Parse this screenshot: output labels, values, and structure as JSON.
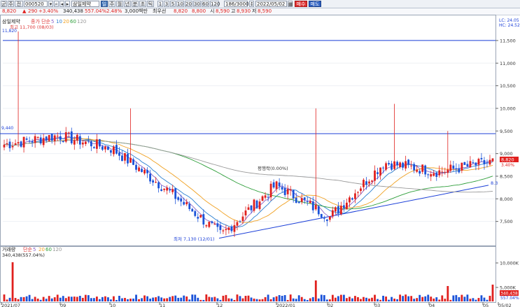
{
  "toolbar": {
    "code": "000520",
    "name": "삼일제약",
    "buttons": [
      "주",
      "월",
      "년",
      "분",
      "초",
      "틱"
    ],
    "selected_button": "일",
    "periods": [
      "1",
      "3",
      "5",
      "10",
      "20",
      "30",
      "60",
      "120"
    ],
    "count": "186/3000",
    "date": "2022/05/02",
    "buy_label": "매수",
    "sell_label": "매도",
    "left_labels": [
      "군",
      "주",
      "전"
    ]
  },
  "status": {
    "price": "8,820",
    "change": "290",
    "change_pct": "+3.40%",
    "volume": "340,438",
    "volume_pct": "557.04%",
    "turnover_pct": "2.48%",
    "amount": "3,000백만",
    "sector": "최우선",
    "open_label": "시",
    "open": "8,820",
    "close_label": "8,800",
    "start_label": "시",
    "start": "8,590",
    "high_label": "고",
    "high": "8,930",
    "low_label": "저",
    "low": "8,590"
  },
  "price_panel": {
    "title": "삼일제약",
    "ma_label": "종가 단순",
    "ma_periods": [
      "5",
      "10",
      "20",
      "60",
      "120"
    ],
    "high_note": "최고 11,700 (08/03)",
    "high_marker": "11,820",
    "left_label": "9,440",
    "lc_label": "LC: 24.05",
    "hc_label": "HC: 24.52",
    "y_ticks": [
      "11,500",
      "11,000",
      "10,500",
      "10,000",
      "9,500",
      "9,000",
      "8,500",
      "8,000",
      "7,500"
    ],
    "last_price": "8,820",
    "last_pct": "3.40%",
    "trend_label": "8.3",
    "mid_note": "평행락(0.00%)",
    "low_note": "최저 7,130 (12/01)",
    "ma_colors": {
      "ma5": "#8a63c9",
      "ma10": "#2a7fd1",
      "ma20": "#f0a020",
      "ma60": "#2e9e3a",
      "ma120": "#999999"
    },
    "resistance_level": 9440,
    "top_level": 11500
  },
  "volume_panel": {
    "title": "거래량",
    "ma_label": "단순",
    "ma_periods": [
      "5",
      "20",
      "60",
      "120"
    ],
    "value": "340,438(557.04%)",
    "y_ticks": [
      "10,000K",
      "5,000K"
    ],
    "last_value": "340,438",
    "last_pct": "557.04%"
  },
  "x_axis": [
    "2021/07",
    "09",
    "10",
    "11",
    "12",
    "2022/01",
    "02",
    "03",
    "04",
    "05",
    "05/02"
  ],
  "chart_data": {
    "type": "candlestick",
    "title": "삼일제약",
    "ylim": [
      7000,
      11700
    ],
    "x": [
      "2021/07",
      "09",
      "10",
      "11",
      "12",
      "2022/01",
      "02",
      "03",
      "04",
      "05"
    ],
    "close_series": [
      9200,
      9400,
      9100,
      8200,
      7200,
      8300,
      7600,
      8800,
      8600,
      8820
    ],
    "annotations": [
      "최고 11,700 (08/03)",
      "최저 7,130 (12/01)",
      "평행락(0.00%)"
    ],
    "resistance": 9440
  }
}
